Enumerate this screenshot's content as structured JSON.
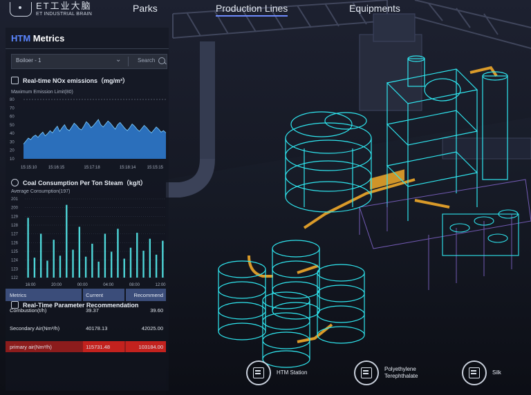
{
  "logo": {
    "cn": "ET工业大脑",
    "en": "ET INDUSTRIAL BRAIN"
  },
  "nav": [
    "Parks",
    "Production Lines",
    "Equipments"
  ],
  "nav_active": "Production Lines",
  "panel": {
    "title_accent": "HTM",
    "title_rest": "Metrics",
    "select_value": "Boiloer - 1",
    "search_label": "Search"
  },
  "nox": {
    "title": "Real-time NOx emissions（mg/m³）",
    "limit_label": "Maximum Emission Limit(80)",
    "y_ticks": [
      "80",
      "70",
      "60",
      "50",
      "40",
      "30",
      "20",
      "10"
    ],
    "x_ticks": [
      "15:15:10",
      "15:16:15",
      "15:17:18",
      "15:18:14",
      "15:15:15"
    ]
  },
  "coal": {
    "title": "Coal Consumption Per Ton Steam（kg/t）",
    "avg_label": "Average Consumption(197)",
    "y_ticks": [
      "201",
      "200",
      "129",
      "128",
      "127",
      "126",
      "125",
      "124",
      "123",
      "122"
    ],
    "x_ticks": [
      "16:00",
      "20:00",
      "00:00",
      "04:00",
      "08:00",
      "12:00"
    ]
  },
  "chart_data": [
    {
      "type": "area",
      "title": "Real-time NOx emissions（mg/m³）",
      "xlabel": "",
      "ylabel": "",
      "ylim": [
        0,
        80
      ],
      "x": [
        "15:15:10",
        "15:16:15",
        "15:17:18",
        "15:18:14",
        "15:15:15"
      ],
      "series": [
        {
          "name": "",
          "values": [
            20,
            24,
            28,
            26,
            30,
            32,
            29,
            33,
            36,
            31,
            34,
            38,
            35,
            40,
            44,
            37,
            42,
            46,
            40,
            38,
            43,
            48,
            45,
            41,
            39,
            44,
            50,
            47,
            42,
            45,
            49,
            53,
            46,
            43,
            47,
            51,
            48,
            44,
            40,
            46,
            49,
            45,
            41,
            38,
            42,
            47,
            44,
            40,
            37,
            41,
            45,
            42,
            38,
            35,
            39,
            43,
            40,
            36,
            38,
            35
          ]
        }
      ]
    },
    {
      "type": "bar",
      "title": "Coal Consumption Per Ton Steam（kg/t）",
      "xlabel": "",
      "ylabel": "",
      "ylim": [
        122,
        201
      ],
      "categories": [
        "16:00",
        "",
        "",
        "",
        "20:00",
        "",
        "",
        "",
        "00:00",
        "",
        "",
        "",
        "04:00",
        "",
        "",
        "",
        "08:00",
        "",
        "",
        "",
        "12:00",
        ""
      ],
      "values": [
        182,
        142,
        166,
        139,
        160,
        144,
        195,
        150,
        173,
        143,
        156,
        138,
        166,
        148,
        171,
        141,
        152,
        167,
        149,
        161,
        145,
        159
      ]
    }
  ],
  "recommend": {
    "title": "Real-Time Parameter Recommendation",
    "headers": [
      "Metrics",
      "Current",
      "Recommend"
    ],
    "rows": [
      {
        "metric": "Combustion(t/h)",
        "current": "39.37",
        "recommend": "39.60",
        "alert": false
      },
      {
        "metric": "Secondary Air(Nm³/h)",
        "current": "40178.13",
        "recommend": "42025.00",
        "alert": false
      },
      {
        "metric": "primary air(Nm³/h)",
        "current": "115731.48",
        "recommend": "103184.00",
        "alert": true
      }
    ]
  },
  "stations": [
    {
      "label1": "HTM Station",
      "label2": ""
    },
    {
      "label1": "Polyethylene",
      "label2": "Terephthalate"
    },
    {
      "label1": "Silk",
      "label2": ""
    }
  ],
  "colors": {
    "accent": "#5b86ff",
    "wire": "#2fe7f0",
    "pipe": "#f0a92a",
    "alert": "#c3221e",
    "bar": "#4ed6d8"
  }
}
